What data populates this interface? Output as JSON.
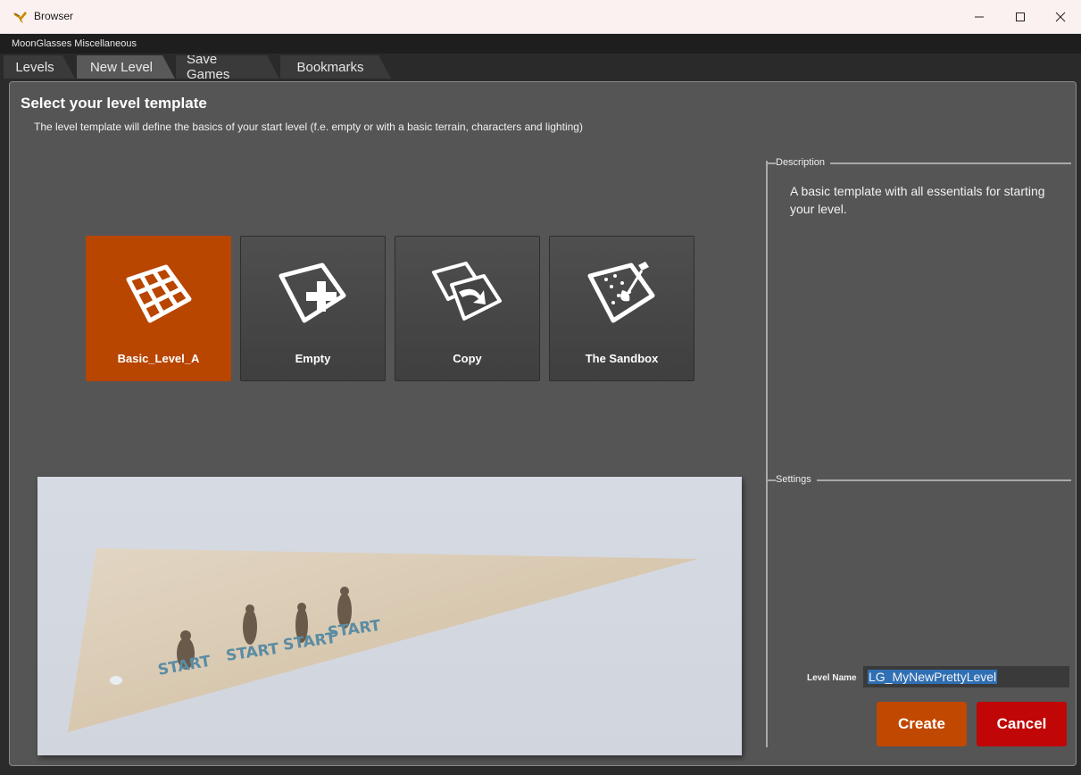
{
  "window": {
    "title": "Browser",
    "subtitle": "MoonGlasses Miscellaneous"
  },
  "tabs": [
    {
      "label": "Levels",
      "active": false
    },
    {
      "label": "New Level",
      "active": true
    },
    {
      "label": "Save Games",
      "active": false
    },
    {
      "label": "Bookmarks",
      "active": false
    }
  ],
  "main": {
    "heading": "Select your level template",
    "subheading": "The level template will define the basics of your start level (f.e. empty or with a basic terrain, characters and lighting)",
    "templates": [
      {
        "label": "Basic_Level_A",
        "icon": "grid-icon",
        "selected": true
      },
      {
        "label": "Empty",
        "icon": "plus-icon",
        "selected": false
      },
      {
        "label": "Copy",
        "icon": "copy-icon",
        "selected": false
      },
      {
        "label": "The Sandbox",
        "icon": "sandbox-icon",
        "selected": false
      }
    ],
    "preview": {
      "start_labels": [
        "START",
        "START",
        "START",
        "START"
      ]
    }
  },
  "side": {
    "description_title": "Description",
    "description_text": "A basic template with all essentials for starting your level.",
    "settings_title": "Settings",
    "level_name_label": "Level Name",
    "level_name_value": "LG_MyNewPrettyLevel"
  },
  "buttons": {
    "create": "Create",
    "cancel": "Cancel"
  },
  "colors": {
    "accent": "#b84500",
    "cancel": "#c00606",
    "panel": "#555555"
  }
}
